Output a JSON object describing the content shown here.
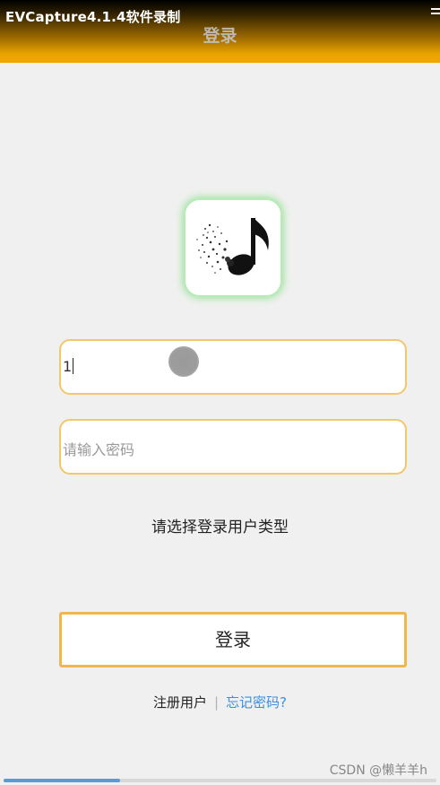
{
  "recorder_watermark": "EVCapture4.1.4软件录制",
  "header": {
    "title": "登录",
    "menu_icon": "menu-icon"
  },
  "logo": {
    "icon": "music-note-icon"
  },
  "form": {
    "username_value": "1",
    "password_placeholder": "请输入密码",
    "user_type_label": "请选择登录用户类型",
    "login_label": "登录"
  },
  "links": {
    "register_label": "注册用户",
    "separator": "|",
    "forgot_label": "忘记密码?"
  },
  "footer_watermark": "CSDN @懒羊羊h",
  "progress": {
    "fraction": 0.27
  },
  "colors": {
    "accent": "#f0a800",
    "field_border": "#f1c86a",
    "link": "#3a8ee6",
    "logo_glow": "#a4e4a4"
  }
}
